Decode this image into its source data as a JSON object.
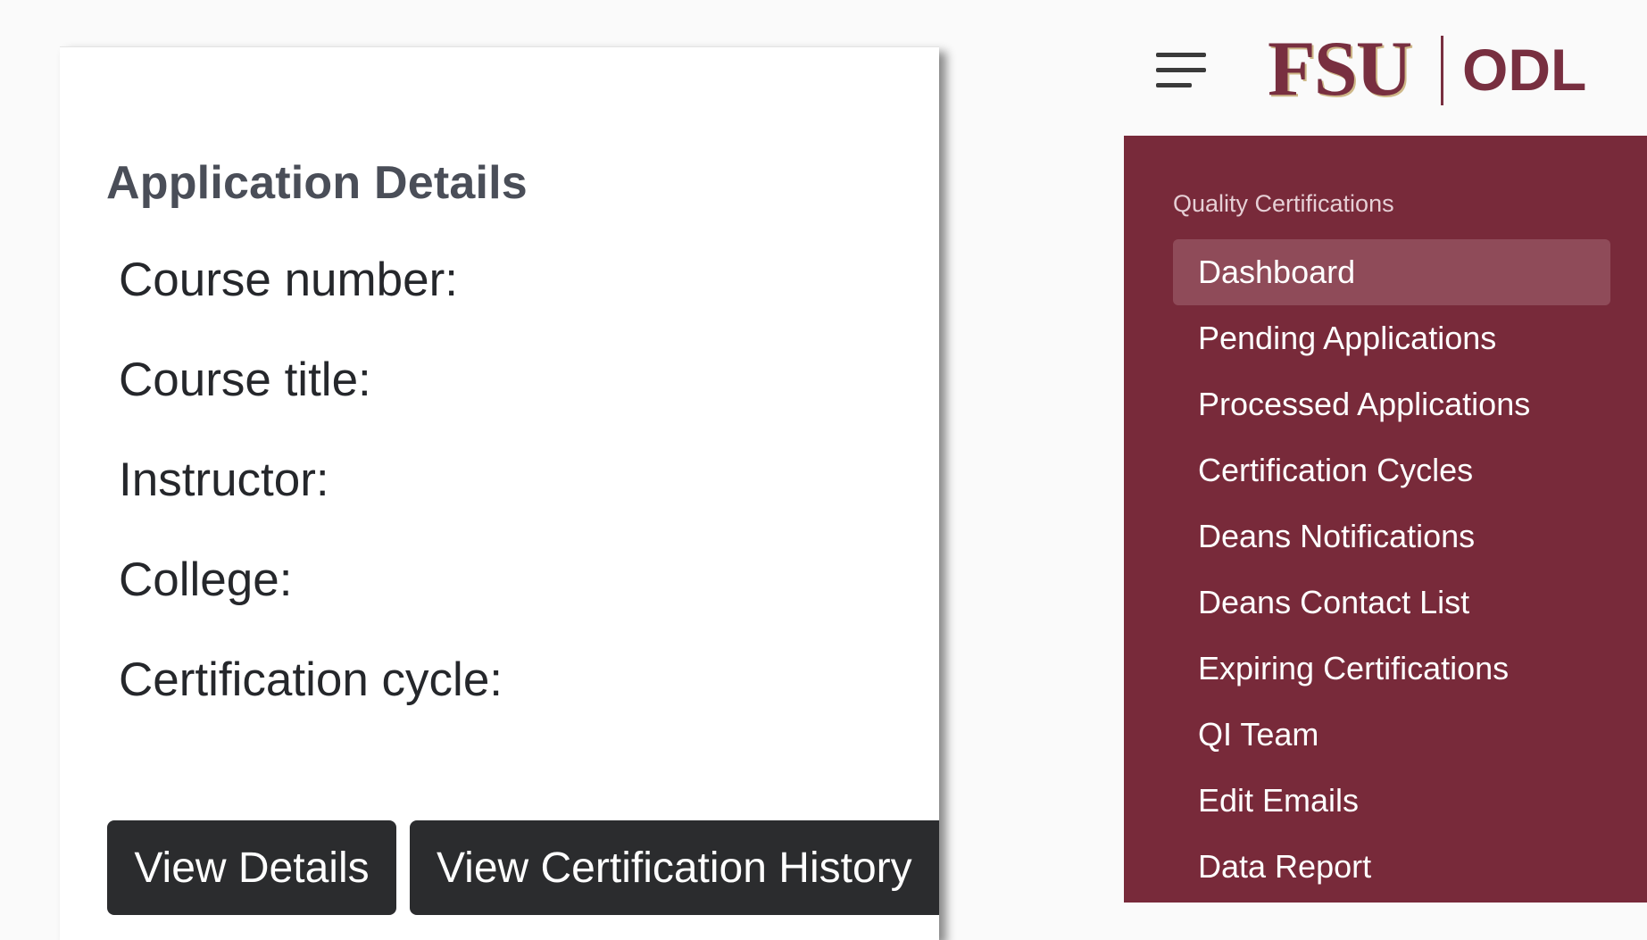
{
  "card": {
    "title": "Application Details",
    "fields": [
      "Course number:",
      "Course title:",
      "Instructor:",
      "College:",
      "Certification cycle:"
    ],
    "buttons": {
      "view_details": "View Details",
      "view_history": "View Certification History"
    }
  },
  "header": {
    "menu_icon": "hamburger-menu-icon",
    "logo_primary": "FSU",
    "logo_secondary": "ODL"
  },
  "sidebar": {
    "heading": "Quality Certifications",
    "items": [
      {
        "label": "Dashboard",
        "active": true
      },
      {
        "label": "Pending Applications"
      },
      {
        "label": "Processed Applications"
      },
      {
        "label": "Certification Cycles"
      },
      {
        "label": "Deans Notifications"
      },
      {
        "label": "Deans Contact List"
      },
      {
        "label": "Expiring Certifications"
      },
      {
        "label": "QI Team"
      },
      {
        "label": "Edit Emails"
      },
      {
        "label": "Data Report"
      }
    ]
  },
  "colors": {
    "brand_garnet": "#782f40",
    "brand_gold": "#ceb888",
    "sidebar_bg": "#782a3a",
    "active_item_bg": "#8f4b59",
    "button_bg": "#2b2c2e"
  }
}
